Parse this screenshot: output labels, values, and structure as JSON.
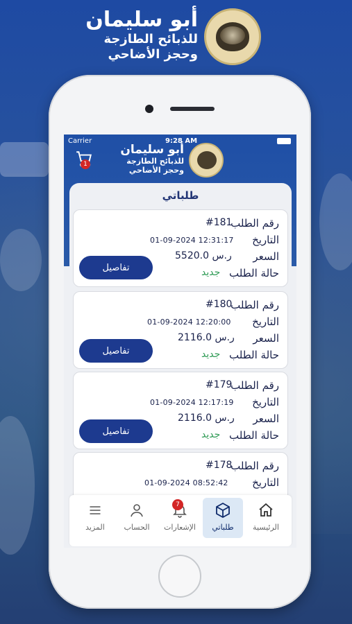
{
  "brand": {
    "title_line1": "أبو سليمان",
    "title_line2": "للذبائح الطازجة",
    "title_line3": "وحجز الأضاحي"
  },
  "status_bar": {
    "carrier": "Carrier",
    "time": "9:28 AM"
  },
  "app_header": {
    "title_line1": "أبو سليمان",
    "title_line2": "للذبائح الطازجة",
    "title_line3": "وحجز الأضاحي",
    "cart_badge": "1"
  },
  "page_title": "طلباتي",
  "labels": {
    "order_number": "رقم الطلب",
    "date": "التاريخ",
    "price": "السعر",
    "status": "حالة الطلب",
    "details_button": "تفاصيل"
  },
  "orders": [
    {
      "number": "#181",
      "date": "01-09-2024  12:31:17",
      "price": "5520.0 ر.س",
      "status": "جديد"
    },
    {
      "number": "#180",
      "date": "01-09-2024  12:20:00",
      "price": "2116.0 ر.س",
      "status": "جديد"
    },
    {
      "number": "#179",
      "date": "01-09-2024  12:17:19",
      "price": "2116.0 ر.س",
      "status": "جديد"
    },
    {
      "number": "#178",
      "date": "01-09-2024  08:52:42",
      "price": "",
      "status": ""
    }
  ],
  "tabbar": {
    "home": "الرئيسية",
    "orders": "طلباتي",
    "notifications": "الإشعارات",
    "notifications_badge": "7",
    "account": "الحساب",
    "more": "المزيد"
  },
  "colors": {
    "primary": "#1d3a8f",
    "status_new": "#2f9b55",
    "badge": "#d32626"
  }
}
